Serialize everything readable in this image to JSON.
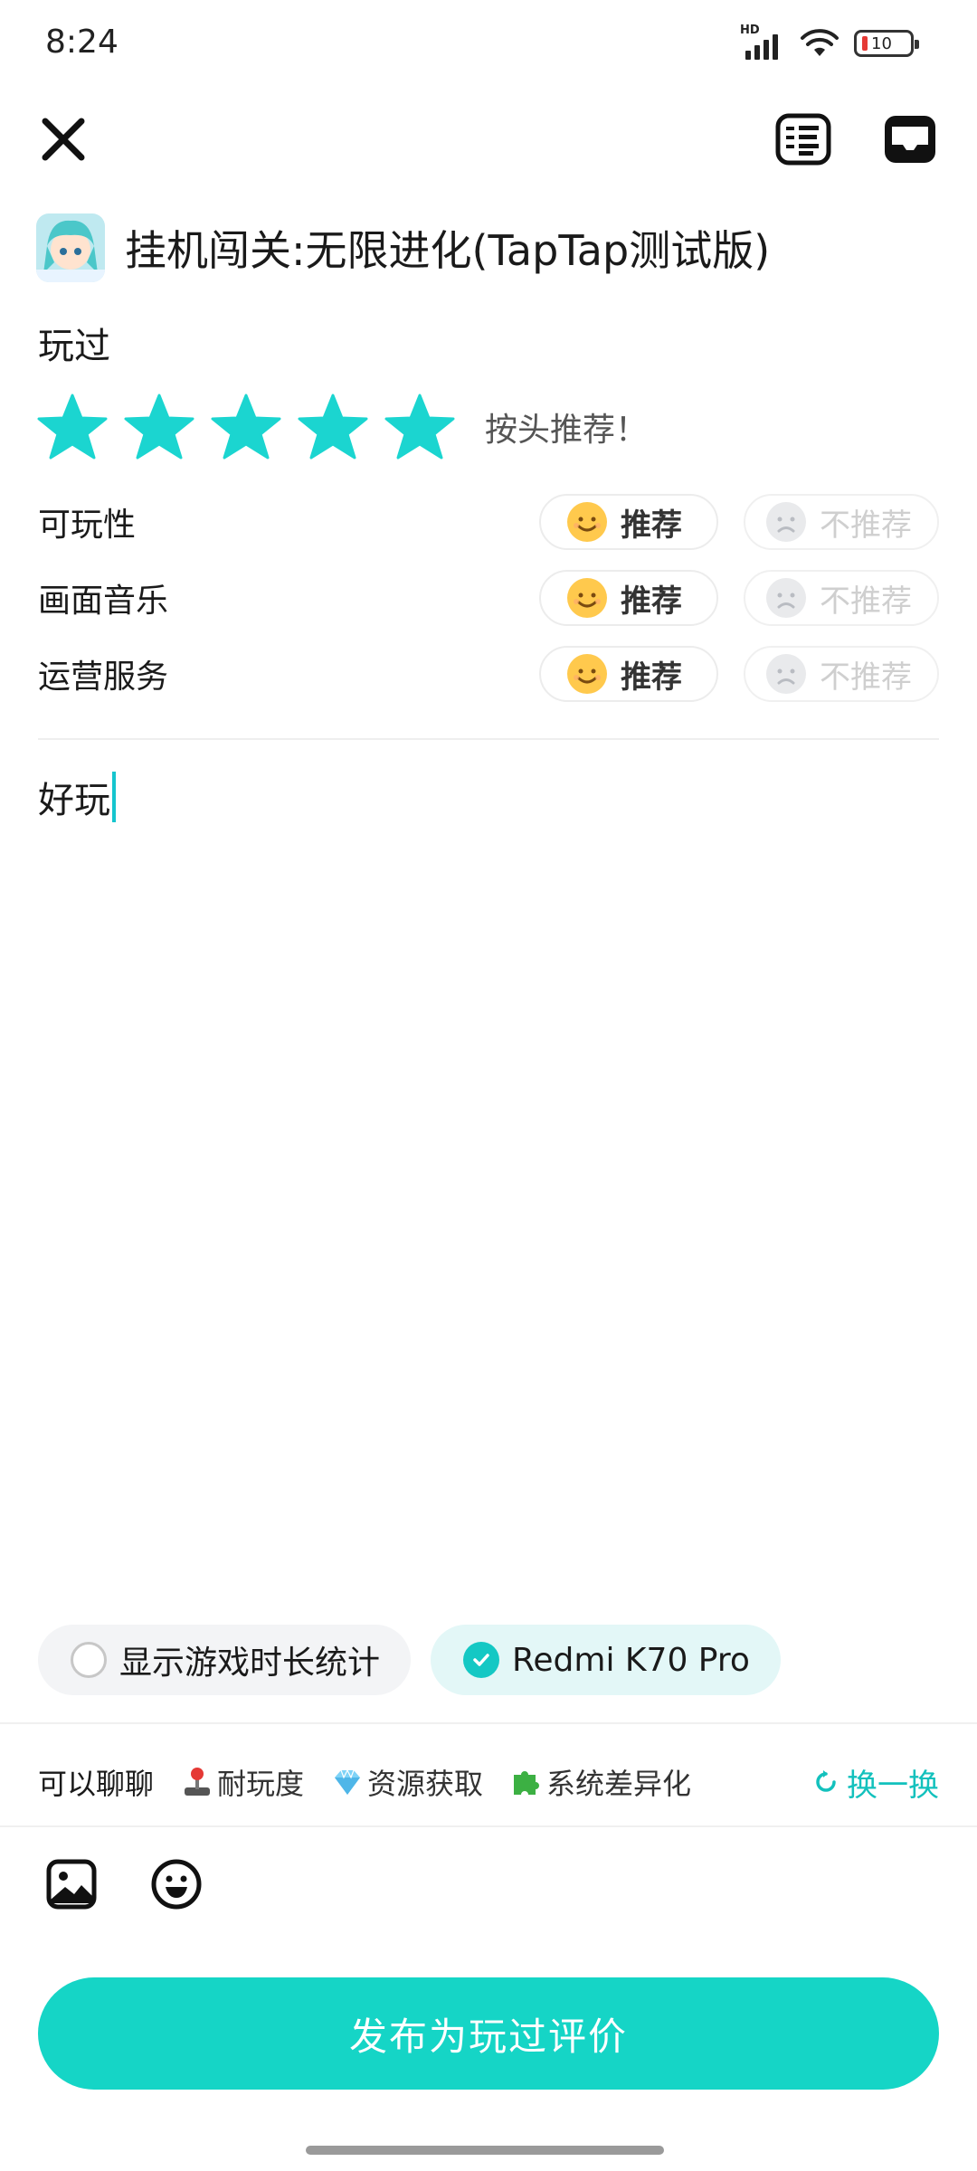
{
  "status_bar": {
    "time": "8:24",
    "network_label": "HD",
    "battery_level": "10"
  },
  "header": {
    "close_icon": "close-icon",
    "rules_icon": "review-rules-icon",
    "draft_icon": "draft-box-icon"
  },
  "game": {
    "title": "挂机闯关:无限进化(TapTap测试版)",
    "icon": "game-avatar-icon"
  },
  "review": {
    "status_label": "玩过",
    "rating": 5,
    "rating_max": 5,
    "rating_caption": "按头推荐！",
    "star_color": "#1bd5d0",
    "text": "好玩"
  },
  "aspects": [
    {
      "label": "可玩性",
      "recommend": "推荐",
      "not_recommend": "不推荐"
    },
    {
      "label": "画面音乐",
      "recommend": "推荐",
      "not_recommend": "不推荐"
    },
    {
      "label": "运营服务",
      "recommend": "推荐",
      "not_recommend": "不推荐"
    }
  ],
  "options": {
    "show_playtime": "显示游戏时长统计",
    "device": "Redmi  K70 Pro"
  },
  "topics": {
    "items": [
      {
        "label": "可以聊聊",
        "icon": ""
      },
      {
        "label": "耐玩度",
        "icon": "joystick-icon"
      },
      {
        "label": "资源获取",
        "icon": "diamond-icon"
      },
      {
        "label": "系统差异化",
        "icon": "puzzle-icon"
      }
    ],
    "refresh_label": "换一换"
  },
  "toolbar": {
    "image_icon": "image-icon",
    "emoji_icon": "emoji-icon"
  },
  "publish": {
    "label": "发布为玩过评价",
    "color": "#15d5c6"
  }
}
